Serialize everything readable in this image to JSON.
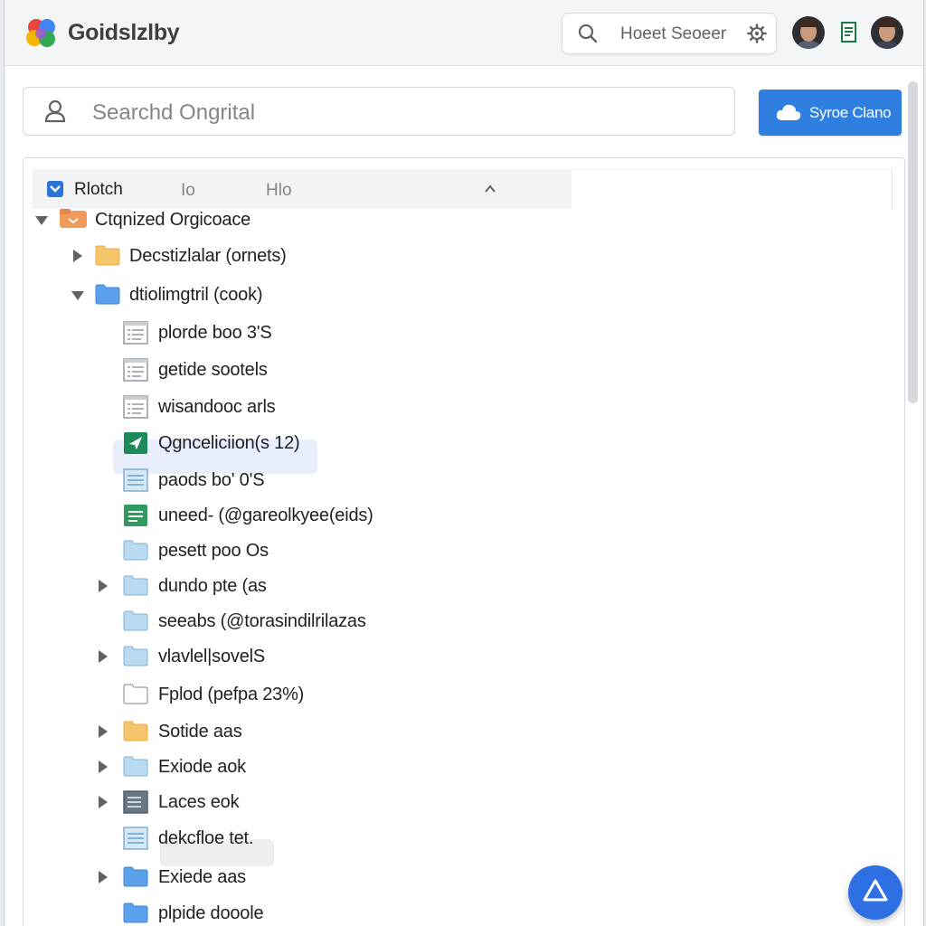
{
  "app": {
    "brand": "Goidslzlby"
  },
  "header": {
    "search_text": "Hoeet Seoeer",
    "icons": [
      "search-icon",
      "gear-icon",
      "document-icon"
    ]
  },
  "search": {
    "placeholder": "Searchd Ongrital"
  },
  "sync_button": {
    "label": "Syroe Clano",
    "icon": "cloud-icon",
    "color": "#2f7fe0"
  },
  "tabs": {
    "active": "Rlotch",
    "second": "Io",
    "third": "Hlo"
  },
  "tree": [
    {
      "label": "Ctqnized Orgicoace",
      "icon": "folder-orange",
      "expander": "down",
      "level": 0
    },
    {
      "label": "Decstizlalar (ornets)",
      "icon": "folder-yellow",
      "expander": "right",
      "level": 1
    },
    {
      "label": "dtiolimgtril (cook)",
      "icon": "folder-blue",
      "expander": "down",
      "level": 1
    },
    {
      "label": "plorde boo 3'S",
      "icon": "doc-lines",
      "expander": "",
      "level": 2
    },
    {
      "label": "getide sootels",
      "icon": "doc-lines",
      "expander": "",
      "level": 2
    },
    {
      "label": "wisandooc arls",
      "icon": "doc-lines",
      "expander": "",
      "level": 2
    },
    {
      "label": "Qgnceliciion(s 12)",
      "icon": "green-plane",
      "expander": "",
      "level": 2,
      "selected": true
    },
    {
      "label": "paods bo' 0'S",
      "icon": "doc-blue-lines",
      "expander": "",
      "level": 2
    },
    {
      "label": "uneed- (@gareolkyee(eids)",
      "icon": "sheet-green",
      "expander": "",
      "level": 2
    },
    {
      "label": "pesett poo Os",
      "icon": "folder-lightblue",
      "expander": "",
      "level": 2
    },
    {
      "label": "dundo pte (as",
      "icon": "folder-lightblue",
      "expander": "right",
      "level": 2
    },
    {
      "label": "seeabs (@torasindilrilazas",
      "icon": "folder-lightblue",
      "expander": "",
      "level": 2
    },
    {
      "label": "vlavlel|sovelS",
      "icon": "folder-lightblue",
      "expander": "right",
      "level": 2
    },
    {
      "label": "Fplod (pefpa 23%)",
      "icon": "folder-white",
      "expander": "",
      "level": 2
    },
    {
      "label": "Sotide aas",
      "icon": "folder-yellow",
      "expander": "right",
      "level": 2
    },
    {
      "label": "Exiode aok",
      "icon": "folder-lightblue",
      "expander": "right",
      "level": 2
    },
    {
      "label": "Laces eok",
      "icon": "doc-dark",
      "expander": "right",
      "level": 2
    },
    {
      "label": "dekcfloe tet.",
      "icon": "doc-blue-lines",
      "expander": "",
      "level": 2,
      "pill": true
    },
    {
      "label": "Exiede aas",
      "icon": "folder-blue",
      "expander": "right",
      "level": 2
    },
    {
      "label": "plpide dooole",
      "icon": "folder-blue",
      "expander": "",
      "level": 2
    }
  ],
  "fab": {
    "icon": "drive-triangle-icon",
    "color": "#2f6fe4"
  }
}
